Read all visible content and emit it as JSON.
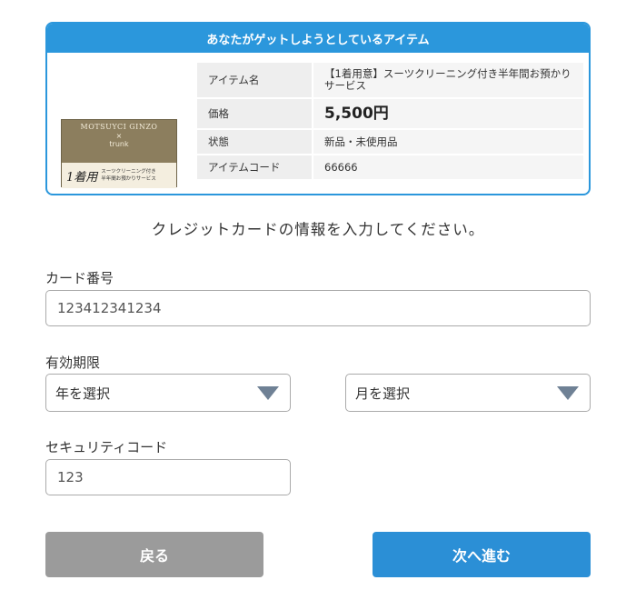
{
  "item": {
    "header": "あなたがゲットしようとしているアイテム",
    "thumbnail": {
      "brand_text": "MOTSUYCI GINZO",
      "cross": "×",
      "trunk": "trunk",
      "big_text": "1着用",
      "small_text_line1": "スーツクリーニング付き",
      "small_text_line2": "半年間お預かりサービス"
    },
    "rows": [
      {
        "label": "アイテム名",
        "value": "【1着用意】スーツクリーニング付き半年間お預かりサービス"
      },
      {
        "label": "価格",
        "value": "5,500円"
      },
      {
        "label": "状態",
        "value": "新品・未使用品"
      },
      {
        "label": "アイテムコード",
        "value": "66666"
      }
    ]
  },
  "instruction": "クレジットカードの情報を入力してください。",
  "card_number": {
    "label": "カード番号",
    "value": "123412341234"
  },
  "expiry": {
    "label": "有効期限",
    "year_selected": "年を選択",
    "month_selected": "月を選択"
  },
  "security_code": {
    "label": "セキュリティコード",
    "value": "123"
  },
  "buttons": {
    "back": "戻る",
    "next": "次へ進む"
  },
  "colors": {
    "accent": "#2b97dc",
    "next_button": "#2b8fd6",
    "back_button": "#9b9b9b",
    "select_arrow": "#6f8195"
  }
}
